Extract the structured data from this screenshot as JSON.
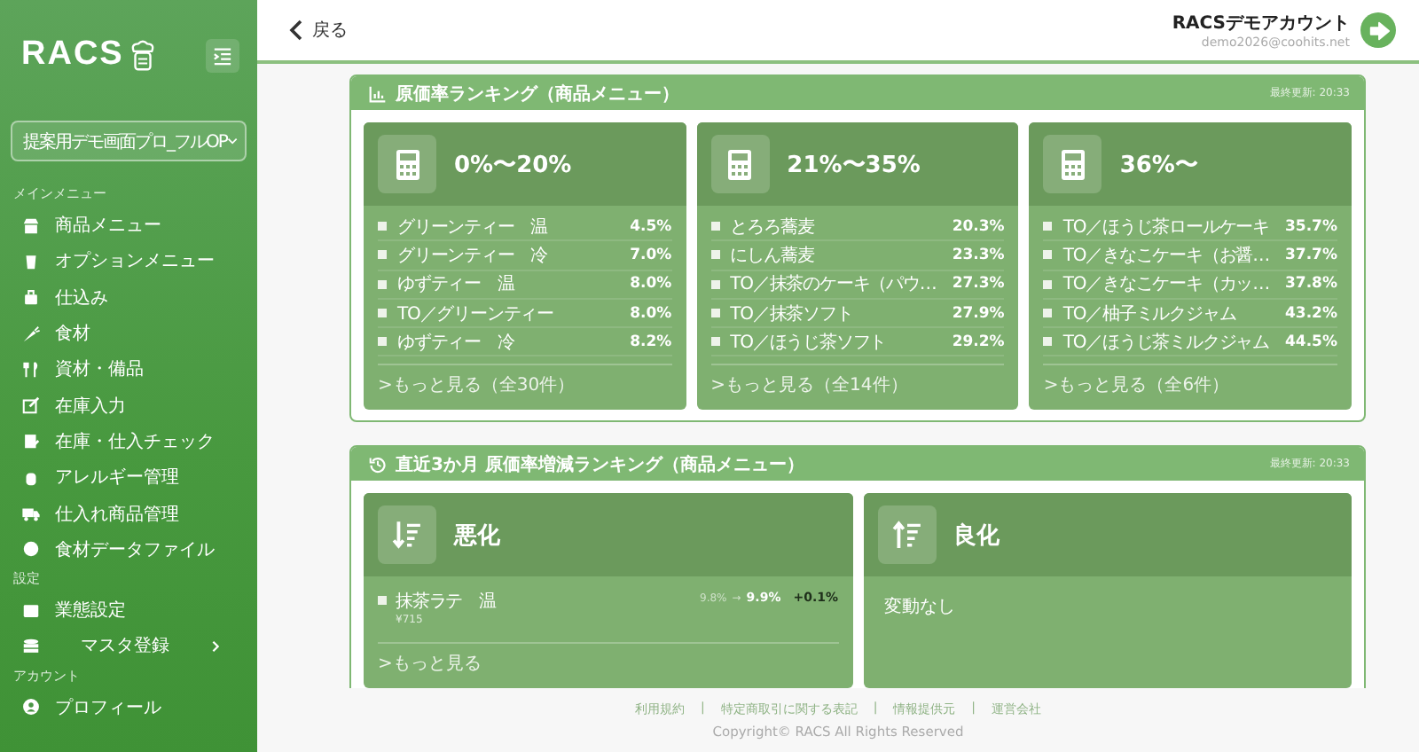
{
  "sidebar": {
    "logo": "RACS",
    "store_select": {
      "value": "提案用デモ画面プロ_フルOP"
    },
    "sections": [
      {
        "title": "メインメニュー",
        "items": [
          {
            "label": "商品メニュー",
            "expandable": false
          },
          {
            "label": "オプションメニュー",
            "expandable": false
          },
          {
            "label": "仕込み",
            "expandable": false
          },
          {
            "label": "食材",
            "expandable": false
          },
          {
            "label": "資材・備品",
            "expandable": false
          },
          {
            "label": "在庫入力",
            "expandable": false
          },
          {
            "label": "在庫・仕入チェック",
            "expandable": false
          },
          {
            "label": "アレルギー管理",
            "expandable": false
          },
          {
            "label": "仕入れ商品管理",
            "expandable": false
          },
          {
            "label": "食材データファイル",
            "expandable": false
          }
        ]
      },
      {
        "title": "設定",
        "items": [
          {
            "label": "業態設定",
            "expandable": false
          },
          {
            "label": "マスタ登録",
            "expandable": true
          }
        ]
      },
      {
        "title": "アカウント",
        "items": [
          {
            "label": "プロフィール",
            "expandable": false
          }
        ]
      }
    ]
  },
  "header": {
    "back": "戻る",
    "account_name": "RACSデモアカウント",
    "account_email": "demo2026@coohits.net"
  },
  "panels": [
    {
      "kind": "ranking",
      "title": "原価率ランキング（商品メニュー）",
      "updated": "最終更新: 20:33",
      "groups": [
        {
          "title": "0%〜20%",
          "items": [
            {
              "name": "グリーンティー　温",
              "rate": "4.5%"
            },
            {
              "name": "グリーンティー　冷",
              "rate": "7.0%"
            },
            {
              "name": "ゆずティー　温",
              "rate": "8.0%"
            },
            {
              "name": "TO／グリーンティー",
              "rate": "8.0%"
            },
            {
              "name": "ゆずティー　冷",
              "rate": "8.2%"
            }
          ],
          "more": ">もっと見る（全30件）"
        },
        {
          "title": "21%〜35%",
          "items": [
            {
              "name": "とろろ蕎麦",
              "rate": "20.3%"
            },
            {
              "name": "にしん蕎麦",
              "rate": "23.3%"
            },
            {
              "name": "TO／抹茶のケーキ（パウ…",
              "rate": "27.3%"
            },
            {
              "name": "TO／抹茶ソフト",
              "rate": "27.9%"
            },
            {
              "name": "TO／ほうじ茶ソフト",
              "rate": "29.2%"
            }
          ],
          "more": ">もっと見る（全14件）"
        },
        {
          "title": "36%〜",
          "items": [
            {
              "name": "TO／ほうじ茶ロールケーキ",
              "rate": "35.7%"
            },
            {
              "name": "TO／きなこケーキ（お醤…",
              "rate": "37.7%"
            },
            {
              "name": "TO／きなこケーキ（カッ…",
              "rate": "37.8%"
            },
            {
              "name": "TO／柚子ミルクジャム",
              "rate": "43.2%"
            },
            {
              "name": "TO／ほうじ茶ミルクジャム",
              "rate": "44.5%"
            }
          ],
          "more": ">もっと見る（全6件）"
        }
      ]
    },
    {
      "kind": "change",
      "title": "直近3か月 原価率増減ランキング（商品メニュー）",
      "updated": "最終更新: 20:33",
      "groups": [
        {
          "title": "悪化",
          "kind": "worse",
          "items": [
            {
              "name": "抹茶ラテ　温",
              "price": "¥715",
              "before": "9.8%",
              "arrow": "→",
              "after": "9.9%",
              "diff": "+0.1%"
            }
          ],
          "more": ">もっと見る"
        },
        {
          "title": "良化",
          "kind": "better",
          "empty_text": "変動なし"
        }
      ]
    }
  ],
  "footer": {
    "links": [
      "利用規約",
      "特定商取引に関する表記",
      "情報提供元",
      "運営会社"
    ],
    "separator": "|",
    "copyright": "Copyright© RACS All Rights Reserved"
  }
}
